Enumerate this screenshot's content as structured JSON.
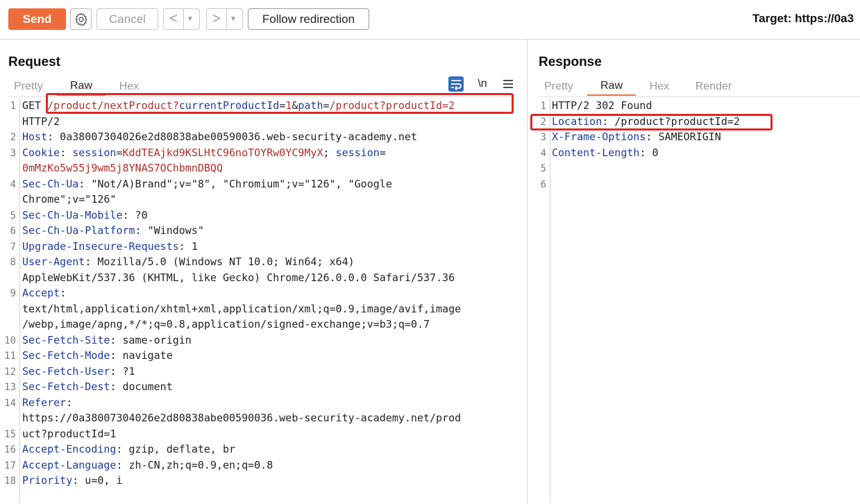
{
  "toolbar": {
    "send_label": "Send",
    "cancel_label": "Cancel",
    "back_glyph": "<",
    "forward_glyph": ">",
    "dropdown_glyph": "▼",
    "follow_label": "Follow redirection",
    "target_text": "Target: https://0a3",
    "icons": [
      "gear-icon",
      "wrap-icon",
      "newline-icon",
      "menu-icon"
    ],
    "accent_color": "#ef6c3a"
  },
  "request": {
    "title": "Request",
    "tabs": [
      "Pretty",
      "Raw",
      "Hex"
    ],
    "active_tab": "Raw",
    "newline_toggle": "\\n",
    "line_numbers": [
      "1",
      "2",
      "3",
      "4",
      "5",
      "6",
      "7",
      "8",
      "9",
      "10",
      "11",
      "12",
      "13",
      "14",
      "15",
      "16",
      "17",
      "18"
    ],
    "rows": [
      {
        "parts": [
          {
            "t": "GET ",
            "c": ""
          },
          {
            "t": "/product/nextProduct?",
            "c": "v"
          },
          {
            "t": "currentProductId",
            "c": "k"
          },
          {
            "t": "=",
            "c": ""
          },
          {
            "t": "1",
            "c": "v"
          },
          {
            "t": "&",
            "c": ""
          },
          {
            "t": "path",
            "c": "k"
          },
          {
            "t": "=",
            "c": ""
          },
          {
            "t": "/product?productId=2",
            "c": "v"
          }
        ]
      },
      {
        "parts": [
          {
            "t": "HTTP/2",
            "c": ""
          }
        ]
      },
      {
        "parts": [
          {
            "t": "Host",
            "c": "k"
          },
          {
            "t": ": 0a38007304026e2d80838abe00590036.web-security-academy.net",
            "c": ""
          }
        ]
      },
      {
        "parts": [
          {
            "t": "Cookie",
            "c": "k"
          },
          {
            "t": ": ",
            "c": ""
          },
          {
            "t": "session",
            "c": "k"
          },
          {
            "t": "=",
            "c": ""
          },
          {
            "t": "KddTEAjkd9KSLHtC96noTOYRw0YC9MyX",
            "c": "v"
          },
          {
            "t": "; ",
            "c": ""
          },
          {
            "t": "session",
            "c": "k"
          },
          {
            "t": "=",
            "c": ""
          }
        ]
      },
      {
        "parts": [
          {
            "t": "0mMzKo5w55j9wm5j8YNAS7OChbmnDBQQ",
            "c": "v"
          }
        ]
      },
      {
        "parts": [
          {
            "t": "Sec-Ch-Ua",
            "c": "k"
          },
          {
            "t": ": \"Not/A)Brand\";v=\"8\", \"Chromium\";v=\"126\", \"Google",
            "c": ""
          }
        ]
      },
      {
        "parts": [
          {
            "t": "Chrome\";v=\"126\"",
            "c": ""
          }
        ]
      },
      {
        "parts": [
          {
            "t": "Sec-Ch-Ua-Mobile",
            "c": "k"
          },
          {
            "t": ": ?0",
            "c": ""
          }
        ]
      },
      {
        "parts": [
          {
            "t": "Sec-Ch-Ua-Platform",
            "c": "k"
          },
          {
            "t": ": \"Windows\"",
            "c": ""
          }
        ]
      },
      {
        "parts": [
          {
            "t": "Upgrade-Insecure-Requests",
            "c": "k"
          },
          {
            "t": ": 1",
            "c": ""
          }
        ]
      },
      {
        "parts": [
          {
            "t": "User-Agent",
            "c": "k"
          },
          {
            "t": ": Mozilla/5.0 (Windows NT 10.0; Win64; x64)",
            "c": ""
          }
        ]
      },
      {
        "parts": [
          {
            "t": "AppleWebKit/537.36 (KHTML, like Gecko) Chrome/126.0.0.0 Safari/537.36",
            "c": ""
          }
        ]
      },
      {
        "parts": [
          {
            "t": "Accept",
            "c": "k"
          },
          {
            "t": ":",
            "c": ""
          }
        ]
      },
      {
        "parts": [
          {
            "t": "text/html,application/xhtml+xml,application/xml;q=0.9,image/avif,image",
            "c": ""
          }
        ]
      },
      {
        "parts": [
          {
            "t": "/webp,image/apng,*/*;q=0.8,application/signed-exchange;v=b3;q=0.7",
            "c": ""
          }
        ]
      },
      {
        "parts": [
          {
            "t": "Sec-Fetch-Site",
            "c": "k"
          },
          {
            "t": ": same-origin",
            "c": ""
          }
        ]
      },
      {
        "parts": [
          {
            "t": "Sec-Fetch-Mode",
            "c": "k"
          },
          {
            "t": ": navigate",
            "c": ""
          }
        ]
      },
      {
        "parts": [
          {
            "t": "Sec-Fetch-User",
            "c": "k"
          },
          {
            "t": ": ?1",
            "c": ""
          }
        ]
      },
      {
        "parts": [
          {
            "t": "Sec-Fetch-Dest",
            "c": "k"
          },
          {
            "t": ": document",
            "c": ""
          }
        ]
      },
      {
        "parts": [
          {
            "t": "Referer",
            "c": "k"
          },
          {
            "t": ":",
            "c": ""
          }
        ]
      },
      {
        "parts": [
          {
            "t": "https://0a38007304026e2d80838abe00590036.web-security-academy.net/prod",
            "c": ""
          }
        ]
      },
      {
        "parts": [
          {
            "t": "uct?productId=1",
            "c": ""
          }
        ]
      },
      {
        "parts": [
          {
            "t": "Accept-Encoding",
            "c": "k"
          },
          {
            "t": ": gzip, deflate, br",
            "c": ""
          }
        ]
      },
      {
        "parts": [
          {
            "t": "Accept-Language",
            "c": "k"
          },
          {
            "t": ": zh-CN,zh;q=0.9,en;q=0.8",
            "c": ""
          }
        ]
      },
      {
        "parts": [
          {
            "t": "Priority",
            "c": "k"
          },
          {
            "t": ": u=0, i",
            "c": ""
          }
        ]
      },
      {
        "parts": [
          {
            "t": "",
            "c": ""
          }
        ]
      }
    ]
  },
  "response": {
    "title": "Response",
    "tabs": [
      "Pretty",
      "Raw",
      "Hex",
      "Render"
    ],
    "active_tab": "Raw",
    "line_numbers": [
      "1",
      "2",
      "3",
      "4",
      "5",
      "6"
    ],
    "rows": [
      {
        "parts": [
          {
            "t": "HTTP/2 302 Found",
            "c": ""
          }
        ]
      },
      {
        "parts": [
          {
            "t": "Location",
            "c": "k"
          },
          {
            "t": ": /product?productId=2",
            "c": ""
          }
        ]
      },
      {
        "parts": [
          {
            "t": "X-Frame-Options",
            "c": "k"
          },
          {
            "t": ": SAMEORIGIN",
            "c": ""
          }
        ]
      },
      {
        "parts": [
          {
            "t": "Content-Length",
            "c": "k"
          },
          {
            "t": ": 0",
            "c": ""
          }
        ]
      },
      {
        "parts": [
          {
            "t": "",
            "c": ""
          }
        ]
      },
      {
        "parts": [
          {
            "t": "",
            "c": ""
          }
        ]
      }
    ]
  }
}
